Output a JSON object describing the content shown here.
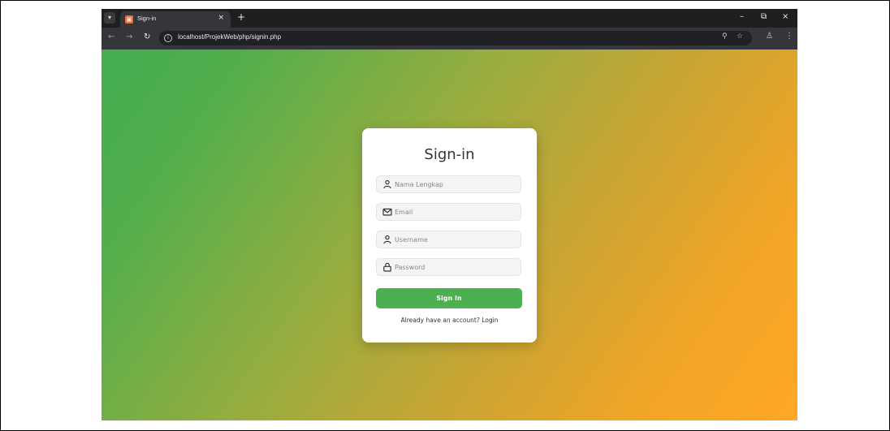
{
  "browser": {
    "tab_title": "Sign-in",
    "url": "localhost/ProjekWeb/php/signin.php",
    "new_tab_glyph": "+",
    "close_glyph": "×",
    "icons": [
      "tab-search-icon",
      "favicon",
      "close-icon",
      "new-tab-icon",
      "minimize-icon",
      "restore-icon",
      "back-icon",
      "forward-icon",
      "reload-icon",
      "site-info-icon",
      "zoom-icon",
      "bookmark-star-icon",
      "profile-icon",
      "menu-icon"
    ]
  },
  "form": {
    "title": "Sign-in",
    "fields": [
      {
        "placeholder": "Nama Lengkap",
        "icon": "user-icon"
      },
      {
        "placeholder": "Email",
        "icon": "envelope-icon"
      },
      {
        "placeholder": "Username",
        "icon": "user-icon"
      },
      {
        "placeholder": "Password",
        "icon": "lock-icon"
      }
    ],
    "submit_label": "Sign In",
    "footer_prefix": "Already have an account? ",
    "login_link": "Login"
  },
  "colors": {
    "button": "#4caf50",
    "gradient_start": "#43ae50",
    "gradient_end": "#ffa726"
  }
}
